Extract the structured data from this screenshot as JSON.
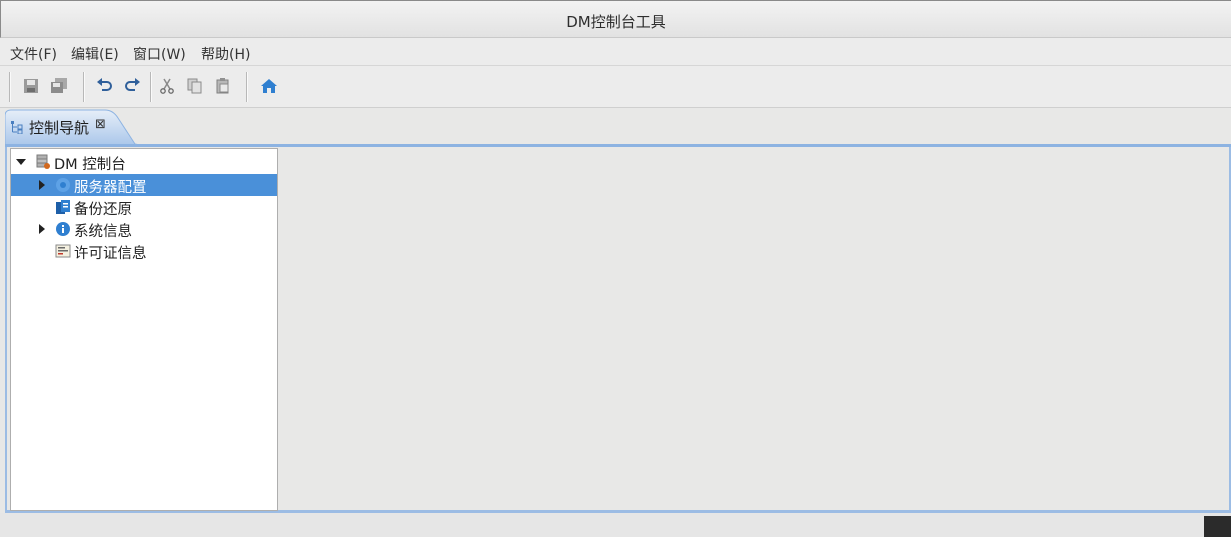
{
  "window": {
    "title": "DM控制台工具"
  },
  "menubar": {
    "items": [
      {
        "label": "文件(F)"
      },
      {
        "label": "编辑(E)"
      },
      {
        "label": "窗口(W)"
      },
      {
        "label": "帮助(H)"
      }
    ]
  },
  "toolbar": {
    "buttons": [
      "save-icon",
      "save-all-icon",
      "undo-icon",
      "redo-icon",
      "cut-icon",
      "copy-icon",
      "paste-icon",
      "home-icon"
    ]
  },
  "tab": {
    "label": "控制导航",
    "close": "⊠"
  },
  "tree": {
    "root": {
      "label": "DM 控制台",
      "expanded": true
    },
    "items": [
      {
        "label": "服务器配置",
        "icon": "server-config-icon",
        "expandable": true,
        "selected": true
      },
      {
        "label": "备份还原",
        "icon": "backup-restore-icon",
        "expandable": false,
        "selected": false
      },
      {
        "label": "系统信息",
        "icon": "info-icon",
        "expandable": true,
        "selected": false
      },
      {
        "label": "许可证信息",
        "icon": "license-icon",
        "expandable": false,
        "selected": false
      }
    ]
  },
  "colors": {
    "selection": "#4a90d9",
    "accent": "#8db3e2",
    "home": "#2f7fd0"
  }
}
